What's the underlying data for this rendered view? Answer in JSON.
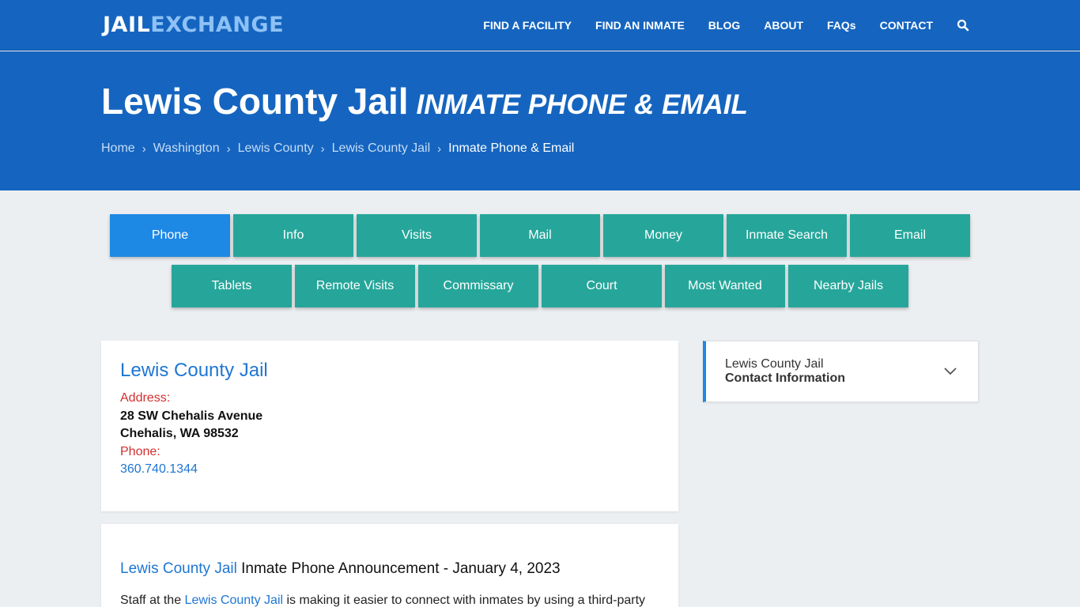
{
  "logo": {
    "part1": "JAIL",
    "part2": "EXCHANGE"
  },
  "nav": {
    "items": [
      "FIND A FACILITY",
      "FIND AN INMATE",
      "BLOG",
      "ABOUT",
      "FAQs",
      "CONTACT"
    ],
    "search_icon": "search-icon"
  },
  "hero": {
    "title": "Lewis County Jail",
    "subtitle": "INMATE PHONE & EMAIL",
    "breadcrumb": [
      "Home",
      "Washington",
      "Lewis County",
      "Lewis County Jail",
      "Inmate Phone & Email"
    ]
  },
  "tabs": {
    "row1": [
      "Phone",
      "Info",
      "Visits",
      "Mail",
      "Money",
      "Inmate Search",
      "Email"
    ],
    "row2": [
      "Tablets",
      "Remote Visits",
      "Commissary",
      "Court",
      "Most Wanted",
      "Nearby Jails"
    ],
    "active": "Phone"
  },
  "facility": {
    "name": "Lewis County Jail",
    "address_label": "Address:",
    "address_line1": "28 SW Chehalis Avenue",
    "address_line2": "Chehalis, WA 98532",
    "phone_label": "Phone:",
    "phone": "360.740.1344"
  },
  "announcement": {
    "link": "Lewis County Jail",
    "heading": " Inmate Phone Announcement - January 4, 2023",
    "body_prefix": "Staff at the ",
    "body_link": "Lewis County Jail",
    "body_suffix": " is making it easier to connect with inmates by using a third-party"
  },
  "sidebar": {
    "line1": "Lewis County Jail",
    "line2": "Contact Information"
  },
  "colors": {
    "header_blue": "#1565c0",
    "tab_teal": "#26a69a",
    "tab_active": "#1e88e5",
    "label_red": "#d32f2f",
    "link_blue": "#1e76d3"
  }
}
